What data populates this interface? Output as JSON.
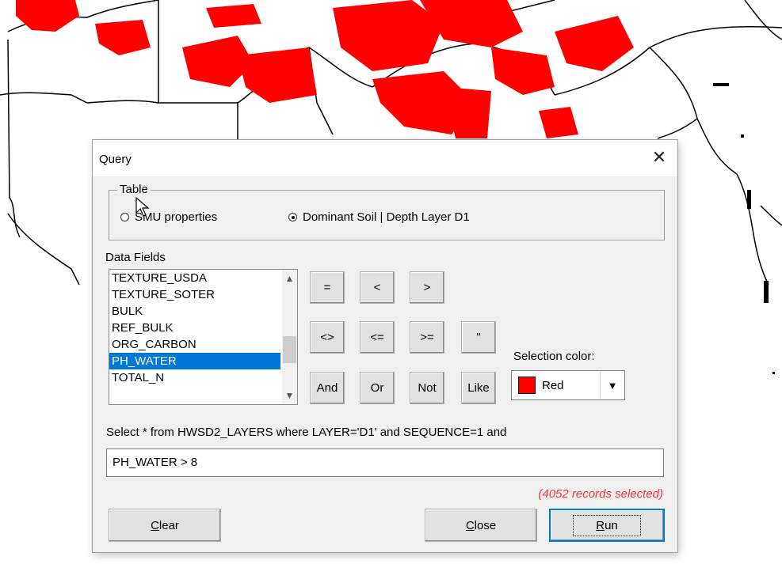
{
  "dialog": {
    "title": "Query",
    "close_symbol": "✕"
  },
  "table_group": {
    "legend": "Table",
    "options": [
      {
        "label": "SMU properties",
        "checked": false
      },
      {
        "label": "Dominant Soil | Depth Layer D1",
        "checked": true
      }
    ]
  },
  "data_fields": {
    "label": "Data Fields",
    "items": [
      "TEXTURE_USDA",
      "TEXTURE_SOTER",
      "BULK",
      "REF_BULK",
      "ORG_CARBON",
      "PH_WATER",
      "TOTAL_N"
    ],
    "selected": "PH_WATER"
  },
  "operators": {
    "row1": [
      "=",
      "<",
      ">"
    ],
    "row2": [
      "<>",
      "<=",
      ">=",
      "\""
    ],
    "row3": [
      "And",
      "Or",
      "Not",
      "Like"
    ]
  },
  "selection_color": {
    "label": "Selection color:",
    "value": "Red",
    "swatch": "#ff0000",
    "arrow": "▼"
  },
  "query": {
    "prefix": "Select * from HWSD2_LAYERS where LAYER='D1' and SEQUENCE=1 and",
    "value": "PH_WATER  > 8",
    "status": "(4052 records selected)"
  },
  "buttons": {
    "clear_first": "C",
    "clear_rest": "lear",
    "close_first": "C",
    "close_rest": "lose",
    "run_first": "R",
    "run_rest": "un"
  },
  "colors": {
    "highlight": "#ff0000",
    "selection": "#0078d7"
  }
}
